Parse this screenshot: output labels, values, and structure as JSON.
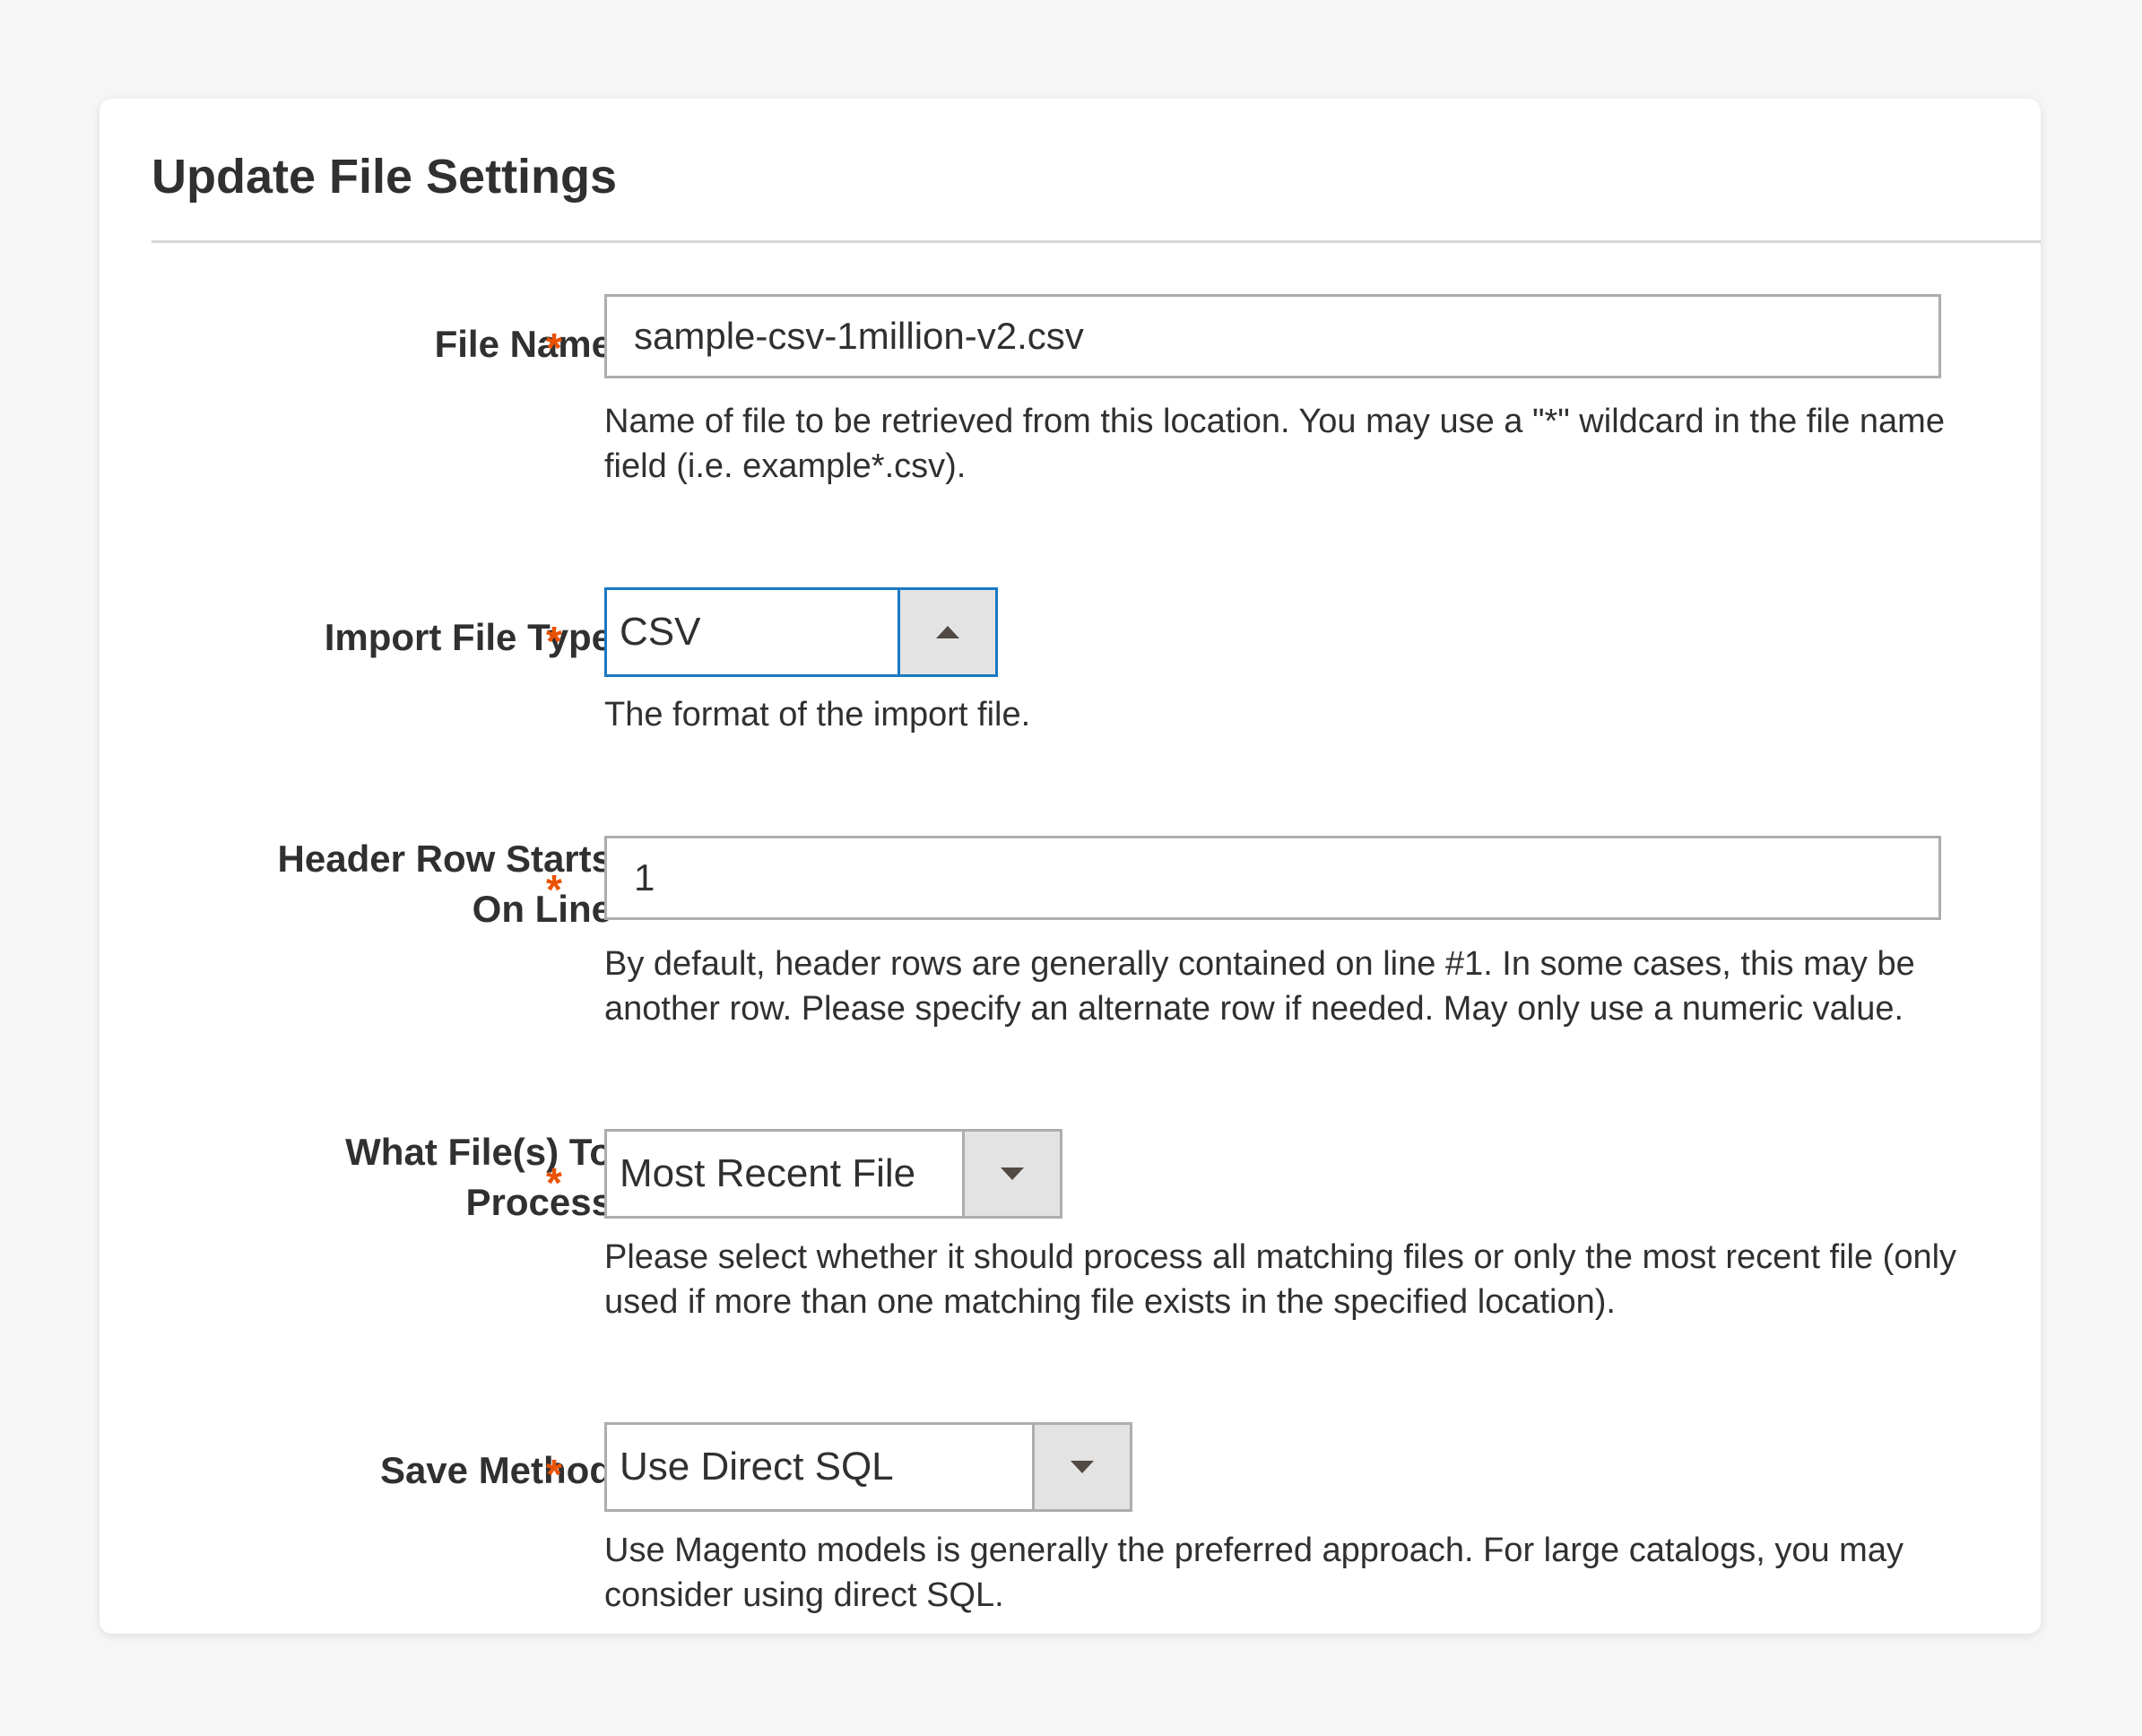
{
  "panel": {
    "title": "Update File Settings"
  },
  "required_marker": "*",
  "fields": {
    "file_name": {
      "label": "File Name",
      "value": "sample-csv-1million-v2.csv",
      "note": "Name of file to be retrieved from this location. You may use a \"*\" wildcard in the file name field (i.e. example*.csv)."
    },
    "import_file_type": {
      "label": "Import File Type",
      "selected": "CSV",
      "expanded": true,
      "note": "The format of the import file."
    },
    "header_row": {
      "label_line1": "Header Row Starts",
      "label_line2": "On Line",
      "value": "1",
      "note": "By default, header rows are generally contained on line #1. In some cases, this may be another row. Please specify an alternate row if needed. May only use a numeric value."
    },
    "what_files": {
      "label_line1": "What File(s) To",
      "label_line2": "Process",
      "selected": "Most Recent File",
      "note": "Please select whether it should process all matching files or only the most recent file (only used if more than one matching file exists in the specified location)."
    },
    "save_method": {
      "label": "Save Method",
      "selected": "Use Direct SQL",
      "note": "Use Magento models is generally the preferred approach. For large catalogs, you may consider using direct SQL."
    }
  },
  "colors": {
    "required": "#eb5202",
    "focus_border": "#1979c3",
    "input_border": "#adadad",
    "select_button_bg": "#e3e3e3",
    "page_bg": "#f6f6f6"
  },
  "icons": {
    "import_file_type_toggle": "caret-up-icon",
    "what_files_toggle": "caret-down-icon",
    "save_method_toggle": "caret-down-icon"
  }
}
